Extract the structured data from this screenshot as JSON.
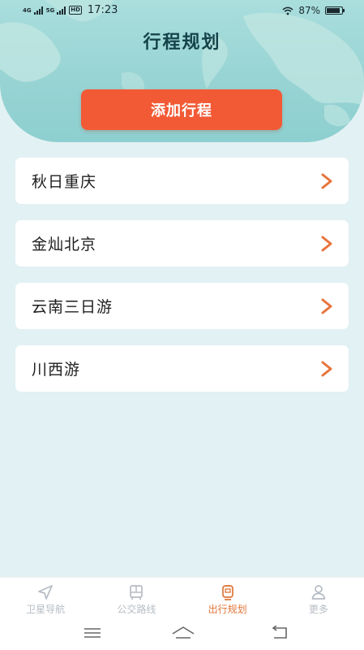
{
  "status_bar": {
    "net1": "4G",
    "net2": "5G",
    "hd": "HD",
    "time": "17:23",
    "battery_text": "87%",
    "battery_level": 0.87
  },
  "header": {
    "title": "行程规划",
    "add_button_label": "添加行程"
  },
  "trips": [
    {
      "name": "秋日重庆"
    },
    {
      "name": "金灿北京"
    },
    {
      "name": "云南三日游"
    },
    {
      "name": "川西游"
    }
  ],
  "tab_bar": {
    "tabs": [
      {
        "label": "卫星导航",
        "icon": "navigation-arrow-icon"
      },
      {
        "label": "公交路线",
        "icon": "bus-icon"
      },
      {
        "label": "出行规划",
        "icon": "train-icon",
        "active": true
      },
      {
        "label": "更多",
        "icon": "person-icon"
      }
    ]
  },
  "colors": {
    "accent": "#f25a35",
    "active_tab": "#e07638",
    "inactive_tab": "#b6bcc4",
    "title": "#14434a",
    "background": "#e2f1f3"
  }
}
